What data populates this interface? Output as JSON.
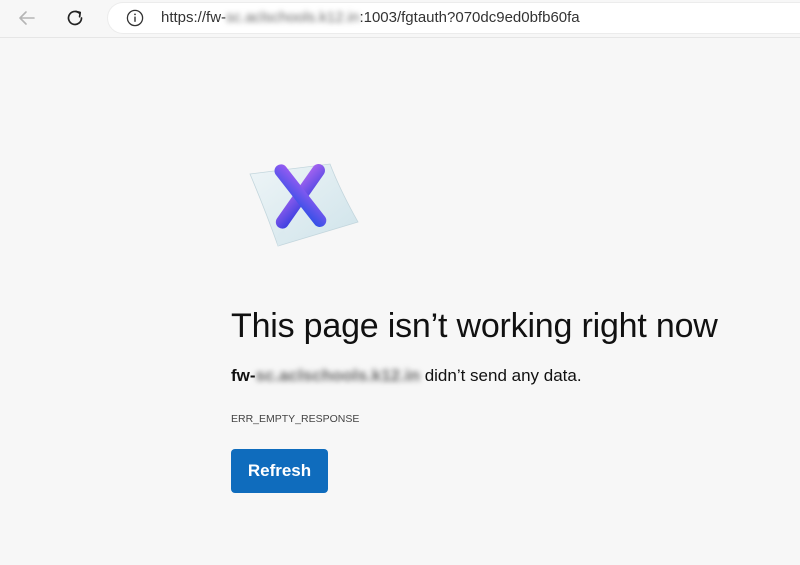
{
  "browser": {
    "url_prefix": "https://fw-",
    "url_hidden": "sc.aclschools.k12.in",
    "url_suffix": ":1003/fgtauth?070dc9ed0bfb60fa",
    "back_icon": "arrow-left-icon",
    "reload_icon": "reload-icon",
    "info_icon": "info-icon"
  },
  "error_page": {
    "headline": "This page isn’t working right now",
    "host_prefix": "fw-",
    "host_hidden": "sc.aclschools.k12.in",
    "message": " didn’t send any data.",
    "error_code": "ERR_EMPTY_RESPONSE",
    "refresh_label": "Refresh",
    "illustration": "error-x-icon",
    "accent_color": "#0f6cbd"
  }
}
